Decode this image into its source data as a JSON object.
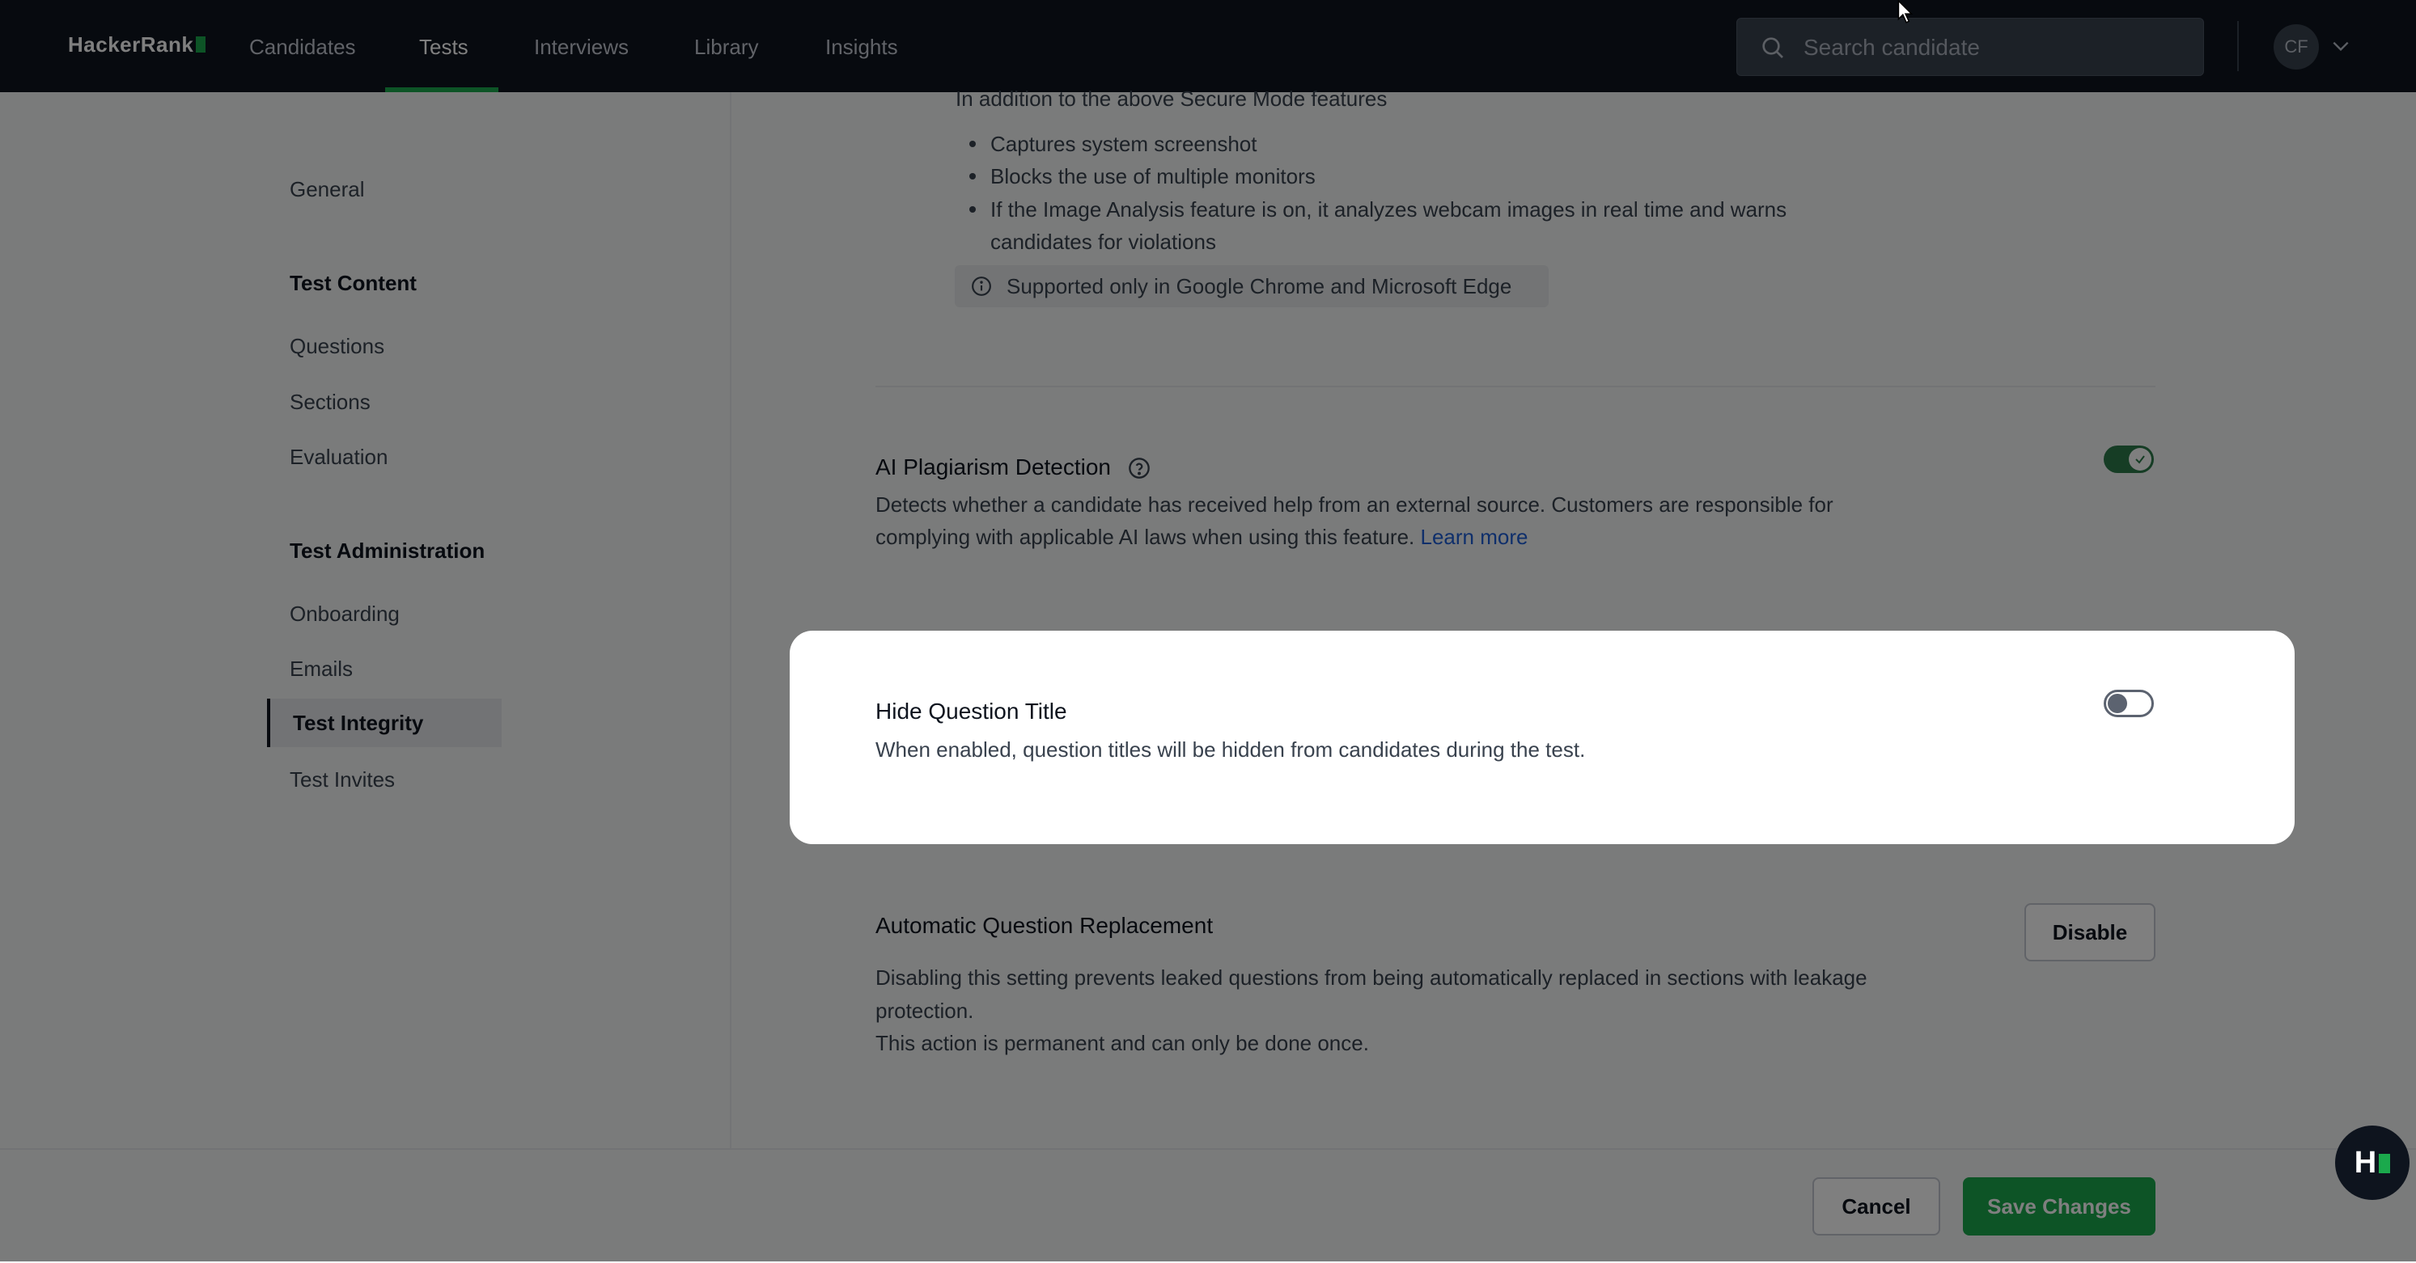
{
  "topnav": {
    "brand": "HackerRank",
    "items": [
      "Candidates",
      "Tests",
      "Interviews",
      "Library",
      "Insights"
    ],
    "active": "Tests",
    "search_placeholder": "Search candidate",
    "avatar_initials": "CF"
  },
  "sidebar": {
    "general": "General",
    "test_content_heading": "Test Content",
    "test_content_items": [
      "Questions",
      "Sections",
      "Evaluation"
    ],
    "test_admin_heading": "Test Administration",
    "test_admin_items": [
      "Onboarding",
      "Emails",
      "Test Integrity",
      "Test Invites"
    ],
    "active": "Test Integrity"
  },
  "secure_mode": {
    "intro": "In addition to the above Secure Mode features",
    "bullets": [
      "Captures system screenshot",
      "Blocks the use of multiple monitors",
      "If the Image Analysis feature is on, it analyzes webcam images in real time and warns",
      "candidates for violations"
    ],
    "note": "Supported only in Google Chrome and Microsoft Edge"
  },
  "ai_plagiarism": {
    "title": "AI Plagiarism Detection",
    "desc_line1": "Detects whether a candidate has received help from an external source. Customers are responsible for",
    "desc_line2": "complying with applicable AI laws when using this feature.",
    "link": "Learn more",
    "enabled": true
  },
  "hide_question_title": {
    "title": "Hide Question Title",
    "desc": "When enabled, question titles will be hidden from candidates during the test.",
    "enabled": false
  },
  "auto_replacement": {
    "title": "Automatic Question Replacement",
    "desc_line1": "Disabling this setting prevents leaked questions from being automatically replaced in sections with leakage",
    "desc_line2": "protection.",
    "desc_line3": "This action is permanent and can only be done once.",
    "button": "Disable"
  },
  "footer": {
    "cancel": "Cancel",
    "save": "Save Changes"
  },
  "colors": {
    "nav_bg": "#0e141e",
    "accent_green": "#1ba94c",
    "link_blue": "#1f5fd6",
    "overlay": "rgba(0,0,0,0.5)"
  }
}
